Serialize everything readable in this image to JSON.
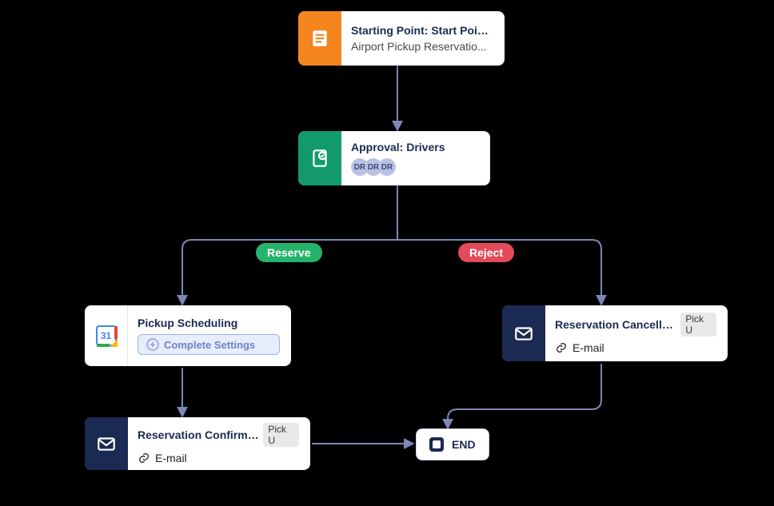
{
  "nodes": {
    "start": {
      "title": "Starting Point: Start Point: Pi...",
      "subtitle": "Airport Pickup Reservatio..."
    },
    "approval": {
      "title": "Approval: Drivers",
      "avatars": [
        "DR",
        "DR",
        "DR"
      ]
    },
    "scheduling": {
      "title": "Pickup Scheduling",
      "button": "Complete Settings",
      "calendar_day": "31"
    },
    "confirmed": {
      "title": "Reservation Confirmed:.",
      "tag": "Pick U",
      "channel": "E-mail"
    },
    "cancelled": {
      "title": "Reservation Cancelled: .",
      "tag": "Pick U",
      "channel": "E-mail"
    },
    "end": {
      "label": "END"
    }
  },
  "decisions": {
    "reserve": "Reserve",
    "reject": "Reject"
  },
  "colors": {
    "orange": "#f5851f",
    "green": "#129a6c",
    "navy": "#1a2a52",
    "pill_green": "#26b36c",
    "pill_red": "#e34a5a",
    "connector": "#7d87b8"
  }
}
